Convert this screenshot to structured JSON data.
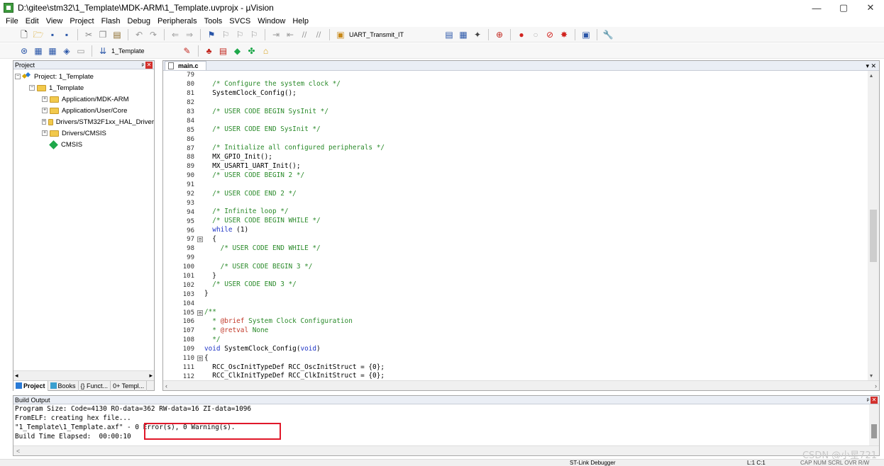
{
  "window": {
    "title": "D:\\gitee\\stm32\\1_Template\\MDK-ARM\\1_Template.uvprojx - µVision",
    "minimize": "—",
    "maximize": "▢",
    "close": "✕"
  },
  "menu": [
    "File",
    "Edit",
    "View",
    "Project",
    "Flash",
    "Debug",
    "Peripherals",
    "Tools",
    "SVCS",
    "Window",
    "Help"
  ],
  "toolbar1": {
    "function_combo": "UART_Transmit_IT"
  },
  "toolbar2": {
    "target_combo": "1_Template"
  },
  "project_panel": {
    "title": "Project",
    "pin": "ᵖ",
    "close": "✕",
    "root": "Project: 1_Template",
    "target": "1_Template",
    "groups": [
      "Application/MDK-ARM",
      "Application/User/Core",
      "Drivers/STM32F1xx_HAL_Driver",
      "Drivers/CMSIS"
    ],
    "cmsis": "CMSIS",
    "tabs": [
      "Project",
      "Books",
      "{} Funct...",
      "0+ Templ..."
    ]
  },
  "editor": {
    "tab": "main.c",
    "lines": [
      {
        "n": "79",
        "t": "",
        "c": "plain"
      },
      {
        "n": "80",
        "t": "  /* Configure the system clock */",
        "c": "comment"
      },
      {
        "n": "81",
        "t": "  SystemClock_Config();",
        "c": "plain"
      },
      {
        "n": "82",
        "t": "",
        "c": "plain"
      },
      {
        "n": "83",
        "t": "  /* USER CODE BEGIN SysInit */",
        "c": "comment"
      },
      {
        "n": "84",
        "t": "",
        "c": "plain"
      },
      {
        "n": "85",
        "t": "  /* USER CODE END SysInit */",
        "c": "comment"
      },
      {
        "n": "86",
        "t": "",
        "c": "plain"
      },
      {
        "n": "87",
        "t": "  /* Initialize all configured peripherals */",
        "c": "comment"
      },
      {
        "n": "88",
        "t": "  MX_GPIO_Init();",
        "c": "plain"
      },
      {
        "n": "89",
        "t": "  MX_USART1_UART_Init();",
        "c": "plain"
      },
      {
        "n": "90",
        "t": "  /* USER CODE BEGIN 2 */",
        "c": "comment"
      },
      {
        "n": "91",
        "t": "",
        "c": "plain"
      },
      {
        "n": "92",
        "t": "  /* USER CODE END 2 */",
        "c": "comment"
      },
      {
        "n": "93",
        "t": "",
        "c": "plain"
      },
      {
        "n": "94",
        "t": "  /* Infinite loop */",
        "c": "comment"
      },
      {
        "n": "95",
        "t": "  /* USER CODE BEGIN WHILE */",
        "c": "comment"
      },
      {
        "n": "96",
        "t": "  while (1)",
        "c": "while"
      },
      {
        "n": "97",
        "t": "  {",
        "c": "plain",
        "fold": "⊟"
      },
      {
        "n": "98",
        "t": "    /* USER CODE END WHILE */",
        "c": "comment"
      },
      {
        "n": "99",
        "t": "",
        "c": "plain"
      },
      {
        "n": "100",
        "t": "    /* USER CODE BEGIN 3 */",
        "c": "comment"
      },
      {
        "n": "101",
        "t": "  }",
        "c": "plain"
      },
      {
        "n": "102",
        "t": "  /* USER CODE END 3 */",
        "c": "comment"
      },
      {
        "n": "103",
        "t": "}",
        "c": "plain"
      },
      {
        "n": "104",
        "t": "",
        "c": "plain"
      },
      {
        "n": "105",
        "t": "/**",
        "c": "comment",
        "fold": "⊟"
      },
      {
        "n": "106",
        "t": "  * @brief System Clock Configuration",
        "c": "doc"
      },
      {
        "n": "107",
        "t": "  * @retval None",
        "c": "doc"
      },
      {
        "n": "108",
        "t": "  */",
        "c": "comment"
      },
      {
        "n": "109",
        "t": "void SystemClock_Config(void)",
        "c": "void"
      },
      {
        "n": "110",
        "t": "{",
        "c": "plain",
        "fold": "⊟"
      },
      {
        "n": "111",
        "t": "  RCC_OscInitTypeDef RCC_OscInitStruct = {0};",
        "c": "plain"
      },
      {
        "n": "112",
        "t": "  RCC_ClkInitTypeDef RCC_ClkInitStruct = {0};",
        "c": "plain"
      }
    ]
  },
  "build_output": {
    "title": "Build Output",
    "lines": [
      "Program Size: Code=4130 RO-data=362 RW-data=16 ZI-data=1096",
      "FromELF: creating hex file...",
      "\"1_Template\\1_Template.axf\" - 0 Error(s), 0 Warning(s).",
      "Build Time Elapsed:  00:00:10"
    ],
    "hscroll_label": "<"
  },
  "statusbar": {
    "debugger": "ST-Link Debugger",
    "position": "L:1 C:1",
    "caps": "CAP NUM SCRL OVR R/W"
  },
  "watermark": "CSDN @小星721"
}
